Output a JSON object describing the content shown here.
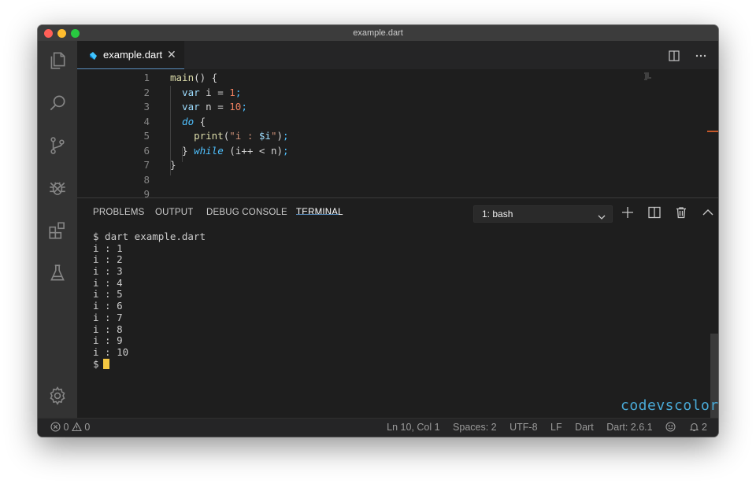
{
  "window": {
    "title": "example.dart"
  },
  "activity_bar": {
    "items": [
      {
        "name": "explorer"
      },
      {
        "name": "search"
      },
      {
        "name": "source-control"
      },
      {
        "name": "debug"
      },
      {
        "name": "extensions"
      },
      {
        "name": "testing"
      },
      {
        "name": "settings"
      }
    ]
  },
  "tabs": [
    {
      "label": "example.dart",
      "active": true,
      "icon": "dart-icon"
    }
  ],
  "editor": {
    "line_numbers": [
      "1",
      "2",
      "3",
      "4",
      "5",
      "6",
      "7",
      "8",
      "9"
    ],
    "lines": [
      [
        {
          "t": "fn",
          "v": "main"
        },
        {
          "t": "punct",
          "v": "() {"
        }
      ],
      [
        {
          "t": "kw",
          "v": "  var"
        },
        {
          "t": "plain",
          "v": " i = "
        },
        {
          "t": "num",
          "v": "1"
        },
        {
          "t": "semi",
          "v": ";"
        }
      ],
      [
        {
          "t": "kw",
          "v": "  var"
        },
        {
          "t": "plain",
          "v": " n = "
        },
        {
          "t": "num",
          "v": "10"
        },
        {
          "t": "semi",
          "v": ";"
        }
      ],
      [
        {
          "t": "ctrl",
          "v": "  do"
        },
        {
          "t": "punct",
          "v": " {"
        }
      ],
      [
        {
          "t": "fn",
          "v": "    print"
        },
        {
          "t": "punct",
          "v": "("
        },
        {
          "t": "str",
          "v": "\"i : "
        },
        {
          "t": "kw",
          "v": "$i"
        },
        {
          "t": "str",
          "v": "\""
        },
        {
          "t": "punct",
          "v": ")"
        },
        {
          "t": "semi",
          "v": ";"
        }
      ],
      [
        {
          "t": "punct",
          "v": "  } "
        },
        {
          "t": "ctrl",
          "v": "while"
        },
        {
          "t": "punct",
          "v": " (i++ < n)"
        },
        {
          "t": "semi",
          "v": ";"
        }
      ],
      [
        {
          "t": "punct",
          "v": "}"
        }
      ],
      [],
      []
    ]
  },
  "panel": {
    "tabs": [
      {
        "label": "PROBLEMS",
        "active": false
      },
      {
        "label": "OUTPUT",
        "active": false
      },
      {
        "label": "DEBUG CONSOLE",
        "active": false
      },
      {
        "label": "TERMINAL",
        "active": true
      }
    ],
    "terminal_select": "1: bash",
    "terminal_lines": [
      "$ dart example.dart",
      "i : 1",
      "i : 2",
      "i : 3",
      "i : 4",
      "i : 5",
      "i : 6",
      "i : 7",
      "i : 8",
      "i : 9",
      "i : 10",
      "$"
    ],
    "watermark": "codevscolor.com"
  },
  "status_bar": {
    "errors": "0",
    "warnings": "0",
    "position": "Ln 10, Col 1",
    "spaces": "Spaces: 2",
    "encoding": "UTF-8",
    "eol": "LF",
    "language": "Dart",
    "sdk": "Dart: 2.6.1",
    "notifications": "2"
  },
  "colors": {
    "background": "#1e1e1e",
    "accent": "#5a8fbf",
    "cursor": "#f5c842",
    "watermark": "#49a9d6"
  }
}
